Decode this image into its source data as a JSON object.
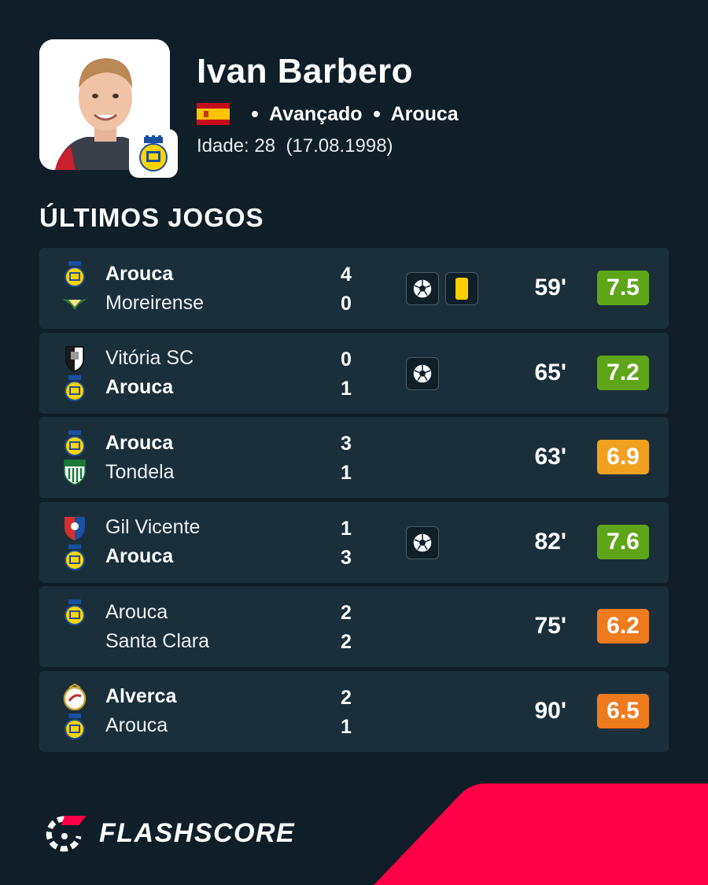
{
  "player": {
    "name": "Ivan Barbero",
    "position": "Avançado",
    "club": "Arouca",
    "age_label": "Idade: 28",
    "birth_date": "(17.08.1998)"
  },
  "section_title": "ÚLTIMOS JOGOS",
  "matches": [
    {
      "home": "Arouca",
      "home_bold": true,
      "home_logo": "arouca-logo",
      "away": "Moreirense",
      "away_bold": false,
      "away_logo": "moreirense-logo",
      "home_score": "4",
      "away_score": "0",
      "events": [
        "goal-icon",
        "yellow-card-icon"
      ],
      "minutes": "59'",
      "rating": "7.5",
      "rating_color": "#5fa51a"
    },
    {
      "home": "Vitória SC",
      "home_bold": false,
      "home_logo": "vitoria-logo",
      "away": "Arouca",
      "away_bold": true,
      "away_logo": "arouca-logo",
      "home_score": "0",
      "away_score": "1",
      "events": [
        "goal-icon"
      ],
      "minutes": "65'",
      "rating": "7.2",
      "rating_color": "#5fa51a"
    },
    {
      "home": "Arouca",
      "home_bold": true,
      "home_logo": "arouca-logo",
      "away": "Tondela",
      "away_bold": false,
      "away_logo": "tondela-logo",
      "home_score": "3",
      "away_score": "1",
      "events": [],
      "minutes": "63'",
      "rating": "6.9",
      "rating_color": "#f2a11f"
    },
    {
      "home": "Gil Vicente",
      "home_bold": false,
      "home_logo": "gil-vicente-logo",
      "away": "Arouca",
      "away_bold": true,
      "away_logo": "arouca-logo",
      "home_score": "1",
      "away_score": "3",
      "events": [
        "goal-icon"
      ],
      "minutes": "82'",
      "rating": "7.6",
      "rating_color": "#5fa51a"
    },
    {
      "home": "Arouca",
      "home_bold": false,
      "home_logo": "arouca-logo",
      "away": "Santa Clara",
      "away_bold": false,
      "away_logo": "",
      "home_score": "2",
      "away_score": "2",
      "events": [],
      "minutes": "75'",
      "rating": "6.2",
      "rating_color": "#ef7b1f"
    },
    {
      "home": "Alverca",
      "home_bold": true,
      "home_logo": "alverca-logo",
      "away": "Arouca",
      "away_bold": false,
      "away_logo": "arouca-logo",
      "home_score": "2",
      "away_score": "1",
      "events": [],
      "minutes": "90'",
      "rating": "6.5",
      "rating_color": "#ef7b1f"
    }
  ],
  "brand": {
    "name": "FLASHSCORE"
  },
  "colors": {
    "background": "#0f1e27",
    "card": "#1a2f3a",
    "accent_red": "#ff0046"
  }
}
